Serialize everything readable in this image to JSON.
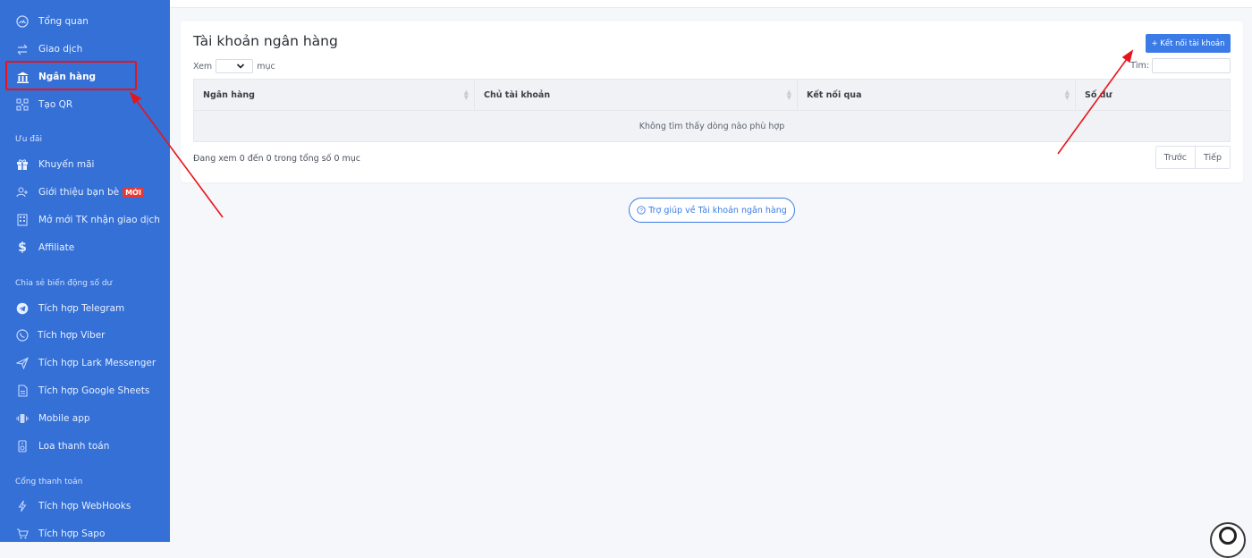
{
  "sidebar": {
    "items": [
      {
        "label": "Tổng quan",
        "icon": "dashboard-icon"
      },
      {
        "label": "Giao dịch",
        "icon": "transfer-icon"
      },
      {
        "label": "Ngân hàng",
        "icon": "bank-icon",
        "active": true
      },
      {
        "label": "Tạo QR",
        "icon": "qr-icon"
      }
    ],
    "sections": [
      {
        "label": "Ưu đãi",
        "items": [
          {
            "label": "Khuyến mãi",
            "icon": "gift-icon"
          },
          {
            "label": "Giới thiệu bạn bè",
            "icon": "add-user-icon",
            "badge": "MỚI"
          },
          {
            "label": "Mở mới TK nhận giao dịch",
            "icon": "building-icon"
          },
          {
            "label": "Affiliate",
            "icon": "dollar-icon"
          }
        ]
      },
      {
        "label": "Chia sẻ biến động số dư",
        "items": [
          {
            "label": "Tích hợp Telegram",
            "icon": "telegram-icon"
          },
          {
            "label": "Tích hợp Viber",
            "icon": "viber-icon"
          },
          {
            "label": "Tích hợp Lark Messenger",
            "icon": "send-icon"
          },
          {
            "label": "Tích hợp Google Sheets",
            "icon": "sheet-icon"
          },
          {
            "label": "Mobile app",
            "icon": "mobile-icon"
          },
          {
            "label": "Loa thanh toán",
            "icon": "speaker-icon"
          }
        ]
      },
      {
        "label": "Cổng thanh toán",
        "items": [
          {
            "label": "Tích hợp WebHooks",
            "icon": "webhook-icon"
          },
          {
            "label": "Tích hợp Sapo",
            "icon": "cart-icon"
          }
        ]
      }
    ]
  },
  "main": {
    "title": "Tài khoản ngân hàng",
    "connect_button": "+ Kết nối tài khoản",
    "length": {
      "prefix": "Xem",
      "suffix": "mục",
      "value": ""
    },
    "search_label": "Tìm:",
    "table": {
      "columns": [
        "Ngân hàng",
        "Chủ tài khoản",
        "Kết nối qua",
        "Số dư"
      ],
      "empty_message": "Không tìm thấy dòng nào phù hợp"
    },
    "info": "Đang xem 0 đến 0 trong tổng số 0 mục",
    "pager": {
      "prev": "Trước",
      "next": "Tiếp"
    },
    "help_link": "Trợ giúp về Tài khoản ngân hàng"
  },
  "colors": {
    "sidebar": "#3470d6",
    "accent": "#3a7be8",
    "annotation": "#e8141b"
  }
}
